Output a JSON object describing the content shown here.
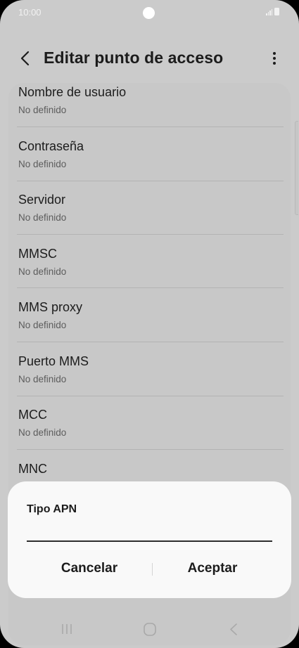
{
  "status_bar": {
    "time": "10:00"
  },
  "header": {
    "title": "Editar punto de acceso",
    "back_icon": "chevron-left-icon",
    "more_icon": "more-vertical-icon"
  },
  "settings_list": {
    "items": [
      {
        "title": "Nombre de usuario",
        "subtitle": "No definido"
      },
      {
        "title": "Contraseña",
        "subtitle": "No definido"
      },
      {
        "title": "Servidor",
        "subtitle": "No definido"
      },
      {
        "title": "MMSC",
        "subtitle": "No definido"
      },
      {
        "title": "MMS proxy",
        "subtitle": "No definido"
      },
      {
        "title": "Puerto MMS",
        "subtitle": "No definido"
      },
      {
        "title": "MCC",
        "subtitle": "No definido"
      },
      {
        "title": "MNC",
        "subtitle": ""
      }
    ]
  },
  "dialog": {
    "title": "Tipo APN",
    "input_value": "",
    "cancel_label": "Cancelar",
    "ok_label": "Aceptar"
  },
  "nav_bar": {
    "recents_icon": "recents-icon",
    "home_icon": "home-icon",
    "back_icon": "back-icon"
  },
  "colors": {
    "dim_background": "#cbcbcb",
    "dialog_background": "#f9f9f9",
    "text_primary": "#1c1c1c",
    "text_secondary": "#5c5c5c"
  }
}
